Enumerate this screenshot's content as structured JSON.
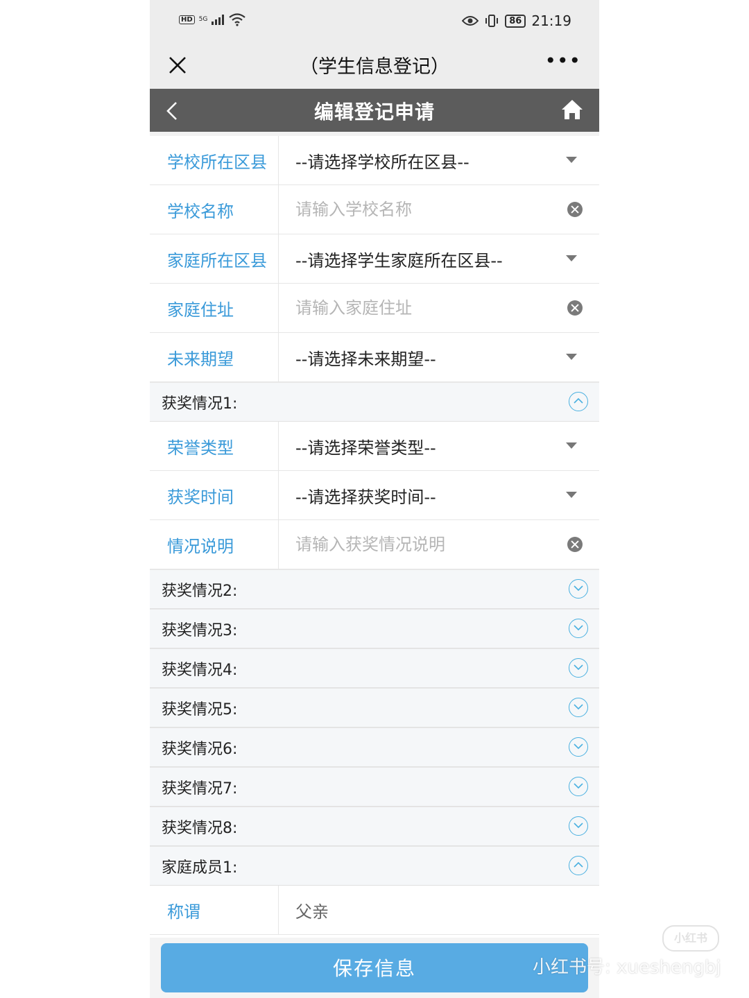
{
  "status_bar": {
    "hd": "HD",
    "network": "5G",
    "battery": "86",
    "time": "21:19"
  },
  "wechat_bar": {
    "title": "（学生信息登记）",
    "more": "•••"
  },
  "app_header": {
    "title": "编辑登记申请"
  },
  "form": {
    "school_district": {
      "label": "学校所在区县",
      "value": "--请选择学校所在区县--"
    },
    "school_name": {
      "label": "学校名称",
      "placeholder": "请输入学校名称"
    },
    "home_district": {
      "label": "家庭所在区县",
      "value": "--请选择学生家庭所在区县--"
    },
    "home_address": {
      "label": "家庭住址",
      "placeholder": "请输入家庭住址"
    },
    "future_hope": {
      "label": "未来期望",
      "value": "--请选择未来期望--"
    },
    "award1": {
      "title": "获奖情况1:",
      "honor_type": {
        "label": "荣誉类型",
        "value": "--请选择荣誉类型--"
      },
      "award_time": {
        "label": "获奖时间",
        "value": "--请选择获奖时间--"
      },
      "description": {
        "label": "情况说明",
        "placeholder": "请输入获奖情况说明"
      }
    },
    "collapsed_sections": [
      "获奖情况2:",
      "获奖情况3:",
      "获奖情况4:",
      "获奖情况5:",
      "获奖情况6:",
      "获奖情况7:",
      "获奖情况8:"
    ],
    "family1": {
      "title": "家庭成员1:",
      "relation": {
        "label": "称谓",
        "value": "父亲"
      }
    }
  },
  "save_button": "保存信息",
  "watermark": {
    "logo": "小红书",
    "text": "小红书号: xueshengbj"
  },
  "colors": {
    "accent": "#3a9ad9",
    "header_bg": "#5c5c5c",
    "button": "#58abe3"
  }
}
